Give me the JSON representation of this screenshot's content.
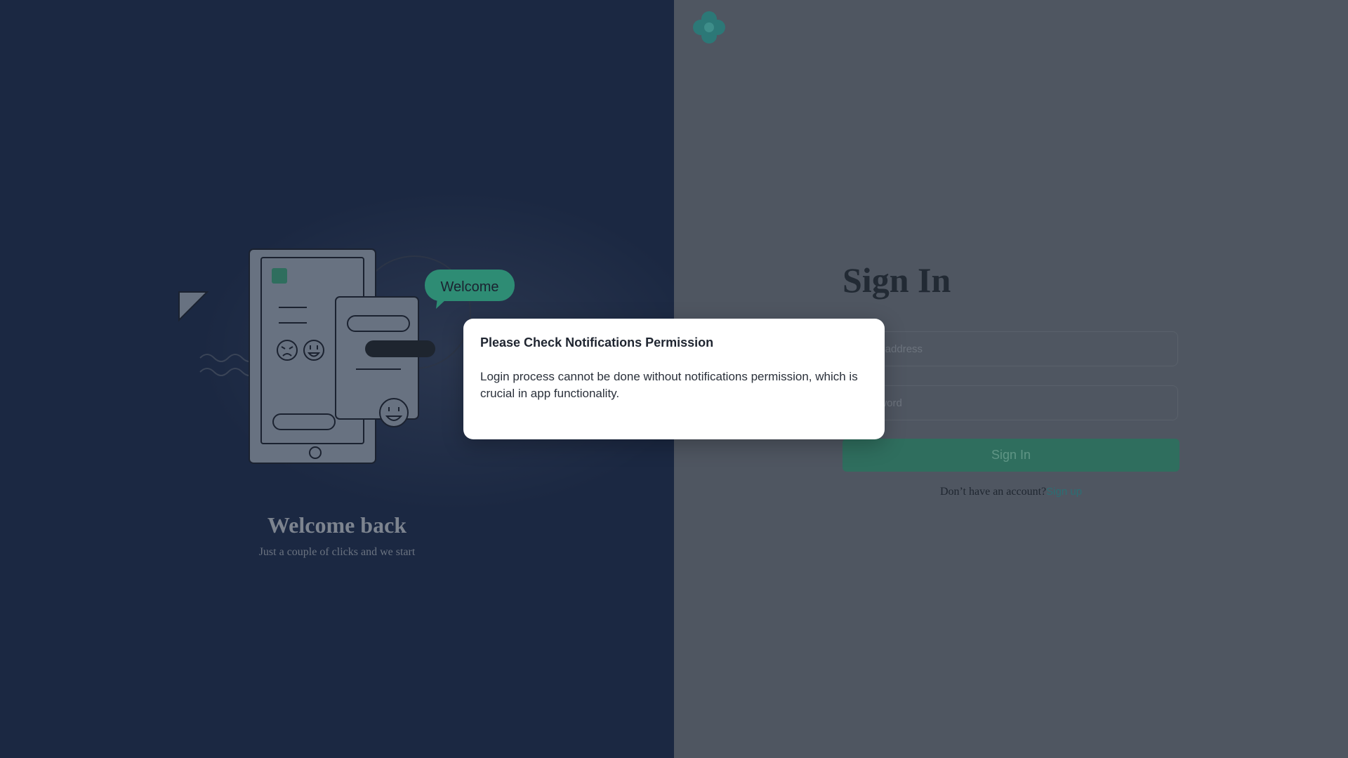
{
  "left": {
    "bubble_text": "Welcome",
    "title": "Welcome back",
    "subtitle": "Just a couple of clicks and we start"
  },
  "signin": {
    "title": "Sign In",
    "email_placeholder": "Email address",
    "password_placeholder": "Password",
    "button_label": "Sign In",
    "account_prompt": "Don’t have an account?",
    "signup_link": "Sign up"
  },
  "modal": {
    "title": "Please Check Notifications Permission",
    "body": "Login process cannot be done without notifications permission, which is crucial in app functionality."
  },
  "colors": {
    "left_bg": "#1b2842",
    "right_bg": "#4f5661",
    "accent_green": "#2f6e5e",
    "bubble_green": "#2e8c74",
    "link": "#2b6f74"
  },
  "icons": [
    "brand-logo-icon",
    "sad-face-icon",
    "happy-face-icon",
    "smiley-icon"
  ]
}
